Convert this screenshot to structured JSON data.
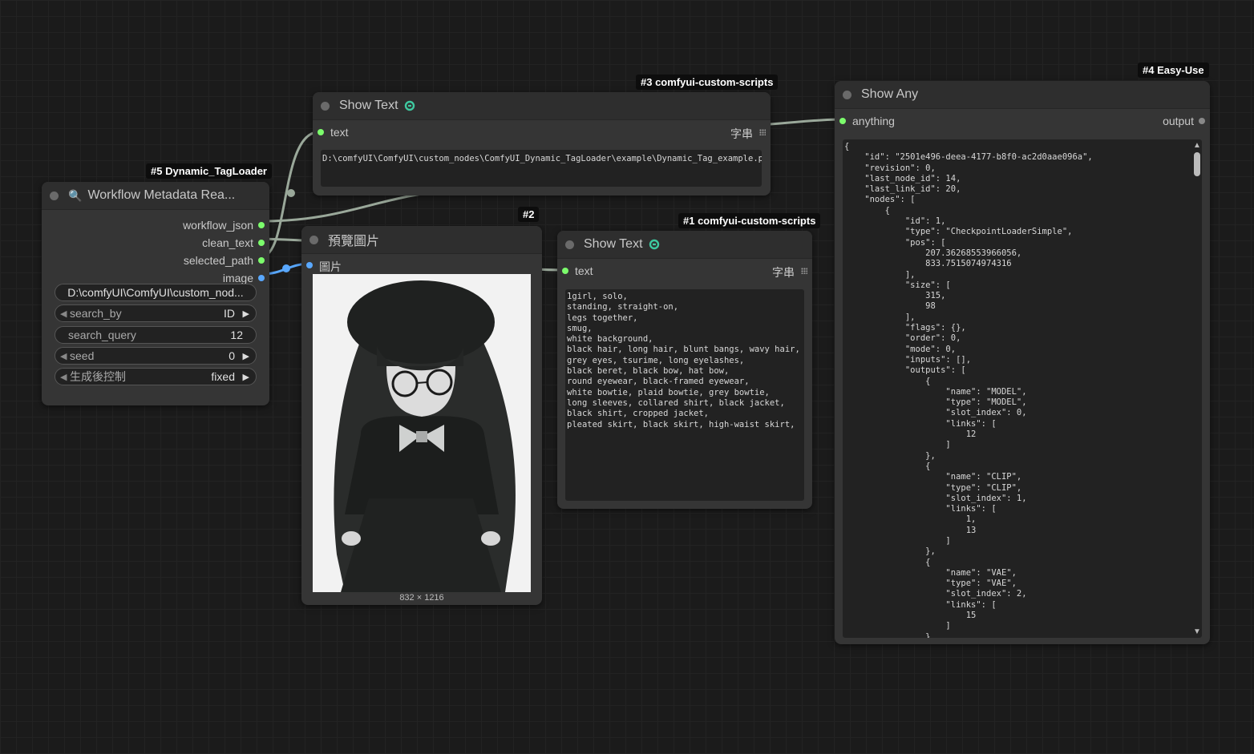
{
  "badges": {
    "n5": "#5 Dynamic_TagLoader",
    "n3": "#3 comfyui-custom-scripts",
    "n2": "#2",
    "n1": "#1 comfyui-custom-scripts",
    "n4": "#4 Easy-Use"
  },
  "node5": {
    "title": "Workflow Metadata Rea...",
    "outputs": [
      "workflow_json",
      "clean_text",
      "selected_path",
      "image"
    ],
    "path_value": "D:\\comfyUI\\ComfyUI\\custom_nod...",
    "widgets": [
      {
        "name": "search_by",
        "value": "ID"
      },
      {
        "name": "search_query",
        "value": "12"
      },
      {
        "name": "seed",
        "value": "0"
      },
      {
        "name": "生成後控制",
        "value": "fixed"
      }
    ]
  },
  "node3": {
    "title": "Show Text",
    "input": "text",
    "type": "字串",
    "value": "D:\\comfyUI\\ComfyUI\\custom_nodes\\ComfyUI_Dynamic_TagLoader\\example\\Dynamic_Tag_example.png"
  },
  "node2": {
    "title": "預覽圖片",
    "input": "圖片",
    "caption": "832 × 1216"
  },
  "node1": {
    "title": "Show Text",
    "input": "text",
    "type": "字串",
    "value": "1girl, solo,\nstanding, straight-on,\nlegs together,\nsmug,\nwhite background,\nblack hair, long hair, blunt bangs, wavy hair,\ngrey eyes, tsurime, long eyelashes,\nblack beret, black bow, hat bow,\nround eyewear, black-framed eyewear,\nwhite bowtie, plaid bowtie, grey bowtie,\nlong sleeves, collared shirt, black jacket,\nblack shirt, cropped jacket,\npleated skirt, black skirt, high-waist skirt,"
  },
  "node4": {
    "title": "Show Any",
    "input": "anything",
    "output": "output",
    "value": "{\n    \"id\": \"2501e496-deea-4177-b8f0-ac2d0aae096a\",\n    \"revision\": 0,\n    \"last_node_id\": 14,\n    \"last_link_id\": 20,\n    \"nodes\": [\n        {\n            \"id\": 1,\n            \"type\": \"CheckpointLoaderSimple\",\n            \"pos\": [\n                207.36268553966056,\n                833.7515074974316\n            ],\n            \"size\": [\n                315,\n                98\n            ],\n            \"flags\": {},\n            \"order\": 0,\n            \"mode\": 0,\n            \"inputs\": [],\n            \"outputs\": [\n                {\n                    \"name\": \"MODEL\",\n                    \"type\": \"MODEL\",\n                    \"slot_index\": 0,\n                    \"links\": [\n                        12\n                    ]\n                },\n                {\n                    \"name\": \"CLIP\",\n                    \"type\": \"CLIP\",\n                    \"slot_index\": 1,\n                    \"links\": [\n                        1,\n                        13\n                    ]\n                },\n                {\n                    \"name\": \"VAE\",\n                    \"type\": \"VAE\",\n                    \"slot_index\": 2,\n                    \"links\": [\n                        15\n                    ]\n                }"
  }
}
